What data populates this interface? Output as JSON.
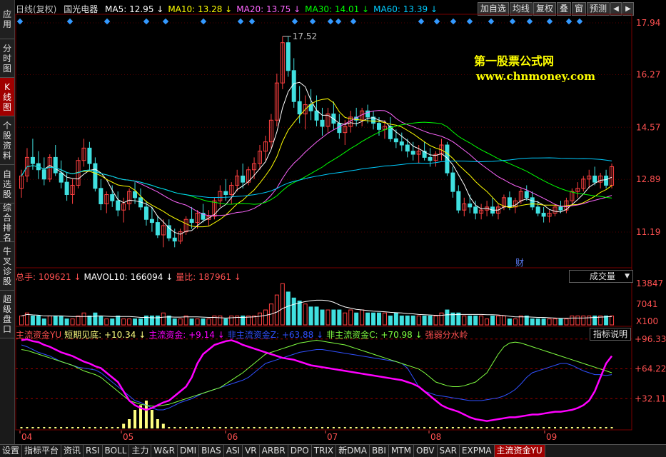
{
  "sidebar": [
    "应用",
    "分时图",
    "K线图",
    "个股资料",
    "自选股",
    "综合排名",
    "牛叉诊股",
    "超级盘口"
  ],
  "sidebar_active": 2,
  "header": {
    "period": "日线(复权)",
    "name": "国光电器",
    "ma": [
      {
        "label": "MA5: 12.95",
        "arrow": "↓",
        "color": "#ffffff"
      },
      {
        "label": "MA10: 13.28",
        "arrow": "↓",
        "color": "#ffff00"
      },
      {
        "label": "MA20: 13.75",
        "arrow": "↓",
        "color": "#ff66ff"
      },
      {
        "label": "MA30: 14.01",
        "arrow": "↓",
        "color": "#00ff00"
      },
      {
        "label": "MA60: 13.39",
        "arrow": "↓",
        "color": "#00ccff"
      }
    ]
  },
  "toolbar": [
    "加自选",
    "均线",
    "复权",
    "叠",
    "窗",
    "预测"
  ],
  "watermark": {
    "line1": "第一股票公式网",
    "line2": "www.chnmoney.com"
  },
  "price_axis": [
    "17.94",
    "16.27",
    "14.57",
    "12.89",
    "11.19"
  ],
  "max_label": "17.52",
  "cai": "财",
  "vol_legend": [
    {
      "label": "总手: 109621",
      "arrow": "↓",
      "color": "#ff5050"
    },
    {
      "label": "MAVOL10: 166094",
      "arrow": "↓",
      "color": "#ffffff"
    },
    {
      "label": "量比: 187961",
      "arrow": "↓",
      "color": "#ff5050"
    }
  ],
  "vol_dropdown": "成交量",
  "vol_axis": [
    "13847",
    "7041",
    "X100"
  ],
  "ind_legend": [
    {
      "label": "主流资金YU",
      "color": "#ff5050"
    },
    {
      "label": "短期见底: +10.34",
      "arrow": "↓",
      "color": "#ffff80"
    },
    {
      "label": "主流资金: +9.14",
      "arrow": "↓",
      "color": "#ff00ff"
    },
    {
      "label": "非主流资金Z: +63.88",
      "arrow": "↓",
      "color": "#3050ff"
    },
    {
      "label": "非主流资金C: +70.98",
      "arrow": "↓",
      "color": "#80ff40"
    },
    {
      "label": "强弱分水岭",
      "color": "#ff5050"
    }
  ],
  "ind_button": "指标说明",
  "ind_axis": [
    "+96.33",
    "+64.22",
    "+32.11"
  ],
  "months": [
    "04",
    "05",
    "06",
    "07",
    "08",
    "09"
  ],
  "bottom_tabs": [
    "设置",
    "指标平台",
    "资讯",
    "RSI",
    "BOLL",
    "主力",
    "W&R",
    "DMI",
    "BIAS",
    "ASI",
    "VR",
    "ARBR",
    "DPO",
    "TRIX",
    "新DMA",
    "BBI",
    "MTM",
    "OBV",
    "SAR",
    "EXPMA",
    "主流资金YU"
  ],
  "bottom_active": 20,
  "chart_data": {
    "type": "candlestick",
    "price_range": [
      10.5,
      18.1
    ],
    "candles": [
      [
        12.6,
        13.2,
        12.3,
        13.0
      ],
      [
        13.0,
        13.9,
        12.8,
        13.6
      ],
      [
        13.6,
        14.2,
        13.2,
        13.4
      ],
      [
        13.4,
        13.8,
        12.9,
        13.2
      ],
      [
        13.2,
        13.6,
        12.7,
        12.9
      ],
      [
        12.9,
        13.7,
        12.8,
        13.6
      ],
      [
        13.6,
        14.0,
        13.0,
        13.1
      ],
      [
        13.1,
        13.5,
        12.6,
        12.8
      ],
      [
        12.8,
        13.1,
        12.2,
        12.4
      ],
      [
        12.4,
        12.9,
        12.1,
        12.7
      ],
      [
        12.7,
        13.6,
        12.6,
        13.5
      ],
      [
        13.5,
        14.2,
        13.3,
        13.9
      ],
      [
        13.9,
        14.1,
        13.2,
        13.4
      ],
      [
        13.4,
        13.6,
        12.5,
        12.6
      ],
      [
        12.6,
        12.9,
        11.9,
        12.1
      ],
      [
        12.1,
        12.5,
        11.8,
        12.4
      ],
      [
        12.4,
        12.7,
        12.0,
        12.2
      ],
      [
        12.2,
        12.5,
        11.7,
        11.9
      ],
      [
        11.9,
        12.3,
        11.5,
        12.1
      ],
      [
        12.1,
        12.6,
        11.9,
        12.5
      ],
      [
        12.5,
        12.8,
        12.1,
        12.3
      ],
      [
        12.3,
        12.6,
        11.9,
        12.0
      ],
      [
        12.0,
        12.2,
        11.4,
        11.6
      ],
      [
        11.6,
        12.0,
        11.2,
        11.5
      ],
      [
        11.5,
        11.7,
        11.0,
        11.1
      ],
      [
        11.1,
        11.6,
        10.7,
        11.4
      ],
      [
        11.4,
        11.6,
        10.9,
        11.0
      ],
      [
        11.0,
        11.3,
        10.7,
        10.9
      ],
      [
        10.9,
        11.3,
        10.8,
        11.2
      ],
      [
        11.2,
        11.7,
        11.1,
        11.6
      ],
      [
        11.6,
        12.0,
        11.3,
        11.5
      ],
      [
        11.5,
        11.9,
        11.3,
        11.8
      ],
      [
        11.8,
        12.1,
        11.5,
        11.6
      ],
      [
        11.6,
        11.9,
        11.4,
        11.7
      ],
      [
        11.7,
        12.3,
        11.6,
        12.2
      ],
      [
        12.2,
        12.7,
        12.0,
        12.5
      ],
      [
        12.5,
        12.9,
        12.2,
        12.4
      ],
      [
        12.4,
        12.8,
        12.1,
        12.7
      ],
      [
        12.7,
        13.2,
        12.5,
        13.0
      ],
      [
        13.0,
        13.4,
        12.6,
        12.8
      ],
      [
        12.8,
        13.3,
        12.7,
        13.2
      ],
      [
        13.2,
        13.6,
        12.9,
        13.4
      ],
      [
        13.4,
        14.0,
        13.2,
        13.8
      ],
      [
        13.8,
        14.3,
        13.5,
        14.1
      ],
      [
        14.1,
        15.0,
        13.9,
        14.8
      ],
      [
        14.8,
        16.3,
        14.6,
        16.0
      ],
      [
        16.0,
        17.5,
        15.8,
        17.3
      ],
      [
        17.3,
        17.5,
        16.2,
        16.4
      ],
      [
        16.4,
        16.8,
        15.2,
        15.4
      ],
      [
        15.4,
        15.9,
        14.7,
        15.0
      ],
      [
        15.0,
        15.6,
        14.5,
        15.3
      ],
      [
        15.3,
        15.8,
        14.8,
        15.1
      ],
      [
        15.1,
        15.6,
        14.6,
        14.8
      ],
      [
        14.8,
        15.2,
        14.3,
        14.6
      ],
      [
        14.6,
        15.2,
        14.4,
        15.0
      ],
      [
        15.0,
        15.4,
        14.5,
        14.7
      ],
      [
        14.7,
        15.0,
        14.2,
        14.4
      ],
      [
        14.4,
        14.8,
        14.0,
        14.6
      ],
      [
        14.6,
        15.1,
        14.4,
        14.9
      ],
      [
        14.9,
        15.2,
        14.6,
        14.8
      ],
      [
        14.8,
        15.2,
        14.6,
        15.1
      ],
      [
        15.1,
        15.3,
        14.7,
        14.9
      ],
      [
        14.9,
        15.1,
        14.5,
        14.7
      ],
      [
        14.7,
        14.9,
        14.3,
        14.5
      ],
      [
        14.5,
        14.8,
        14.2,
        14.6
      ],
      [
        14.6,
        14.9,
        14.1,
        14.2
      ],
      [
        14.2,
        14.5,
        13.9,
        14.1
      ],
      [
        14.1,
        14.4,
        13.8,
        14.0
      ],
      [
        14.0,
        14.2,
        13.6,
        13.8
      ],
      [
        13.8,
        14.1,
        13.5,
        13.7
      ],
      [
        13.7,
        14.0,
        13.4,
        13.8
      ],
      [
        13.8,
        14.1,
        13.5,
        13.6
      ],
      [
        13.6,
        13.9,
        13.3,
        13.5
      ],
      [
        13.5,
        13.8,
        13.3,
        13.7
      ],
      [
        13.7,
        14.2,
        13.5,
        14.0
      ],
      [
        14.0,
        14.1,
        13.0,
        13.1
      ],
      [
        13.1,
        13.3,
        12.3,
        12.5
      ],
      [
        12.5,
        12.7,
        11.8,
        11.9
      ],
      [
        11.9,
        12.3,
        11.7,
        12.1
      ],
      [
        12.1,
        12.4,
        11.8,
        12.0
      ],
      [
        12.0,
        12.2,
        11.6,
        11.8
      ],
      [
        11.8,
        12.1,
        11.6,
        11.9
      ],
      [
        11.9,
        12.2,
        11.7,
        12.0
      ],
      [
        12.0,
        12.3,
        11.7,
        11.8
      ],
      [
        11.8,
        12.1,
        11.6,
        12.0
      ],
      [
        12.0,
        12.4,
        11.9,
        12.3
      ],
      [
        12.3,
        12.5,
        11.9,
        12.0
      ],
      [
        12.0,
        12.3,
        11.8,
        12.2
      ],
      [
        12.2,
        12.6,
        12.1,
        12.5
      ],
      [
        12.5,
        12.7,
        12.2,
        12.3
      ],
      [
        12.3,
        12.5,
        11.9,
        12.0
      ],
      [
        12.0,
        12.2,
        11.7,
        11.8
      ],
      [
        11.8,
        12.0,
        11.5,
        11.7
      ],
      [
        11.7,
        11.9,
        11.5,
        11.8
      ],
      [
        11.8,
        12.1,
        11.7,
        12.0
      ],
      [
        12.0,
        12.2,
        11.8,
        11.9
      ],
      [
        11.9,
        12.3,
        11.8,
        12.2
      ],
      [
        12.2,
        12.6,
        12.1,
        12.5
      ],
      [
        12.5,
        12.8,
        12.3,
        12.6
      ],
      [
        12.6,
        13.0,
        12.5,
        12.9
      ],
      [
        12.9,
        13.2,
        12.6,
        13.0
      ],
      [
        13.0,
        13.3,
        12.7,
        12.8
      ],
      [
        12.8,
        13.1,
        12.6,
        13.0
      ],
      [
        13.0,
        13.2,
        12.6,
        12.7
      ],
      [
        12.7,
        13.4,
        12.6,
        13.3
      ]
    ],
    "ma5_last": 12.95,
    "ma10_last": 13.28,
    "ma20_last": 13.75,
    "ma30_last": 14.01,
    "ma60_last": 13.39,
    "volume_max": 13847,
    "volume": [
      3,
      4,
      3,
      3,
      2,
      3,
      3,
      3,
      2,
      2,
      3,
      4,
      3,
      4,
      3,
      2,
      2,
      3,
      2,
      2,
      2,
      2,
      3,
      3,
      3,
      4,
      3,
      2,
      2,
      3,
      2,
      2,
      2,
      2,
      3,
      3,
      2,
      3,
      3,
      3,
      3,
      3,
      4,
      5,
      7,
      10,
      13.8,
      11,
      9,
      8,
      7,
      6,
      6,
      5,
      5,
      5,
      5,
      4,
      5,
      4,
      5,
      4,
      4,
      4,
      4,
      3,
      4,
      3,
      3,
      3,
      3,
      3,
      3,
      3,
      4,
      5,
      4,
      4,
      3,
      3,
      3,
      3,
      2,
      3,
      3,
      3,
      2,
      2,
      3,
      3,
      2,
      2,
      2,
      2,
      2,
      2,
      2,
      3,
      3,
      3,
      3,
      3,
      3,
      3,
      3,
      4
    ],
    "indicator_range": [
      0,
      100
    ],
    "short_bottom": [
      0,
      0,
      0,
      0,
      0,
      0,
      0,
      0,
      0,
      0,
      0,
      0,
      0,
      0,
      0,
      0,
      0,
      0,
      5,
      10,
      20,
      25,
      30,
      20,
      10,
      5,
      0,
      0,
      0,
      0,
      0,
      0,
      0,
      0,
      0,
      0,
      0,
      0,
      0,
      0,
      0,
      0,
      0,
      0,
      0,
      0,
      0,
      0,
      0,
      0,
      0,
      0,
      0,
      0,
      0,
      0,
      0,
      0,
      0,
      0,
      0,
      0,
      0,
      0,
      0,
      0,
      0,
      0,
      0,
      0,
      0,
      0,
      0,
      0,
      0,
      0,
      0,
      0,
      0,
      0,
      0,
      0,
      0,
      0,
      0,
      0,
      0,
      0,
      0,
      0,
      0,
      0,
      0,
      0,
      0,
      0,
      0,
      0,
      0,
      0,
      0,
      0,
      0,
      0,
      0,
      0,
      0,
      0
    ],
    "main_fund": [
      95,
      96,
      94,
      93,
      90,
      88,
      85,
      82,
      80,
      78,
      75,
      72,
      70,
      67,
      65,
      60,
      55,
      50,
      40,
      30,
      25,
      22,
      20,
      22,
      25,
      28,
      30,
      35,
      40,
      45,
      55,
      70,
      80,
      85,
      90,
      92,
      94,
      95,
      93,
      90,
      88,
      86,
      84,
      82,
      80,
      78,
      76,
      75,
      74,
      72,
      70,
      68,
      67,
      66,
      65,
      64,
      63,
      62,
      61,
      60,
      59,
      58,
      57,
      56,
      55,
      54,
      53,
      52,
      50,
      48,
      45,
      40,
      35,
      30,
      25,
      22,
      20,
      18,
      15,
      12,
      10,
      9,
      8,
      9,
      10,
      11,
      12,
      12,
      13,
      14,
      15,
      15,
      16,
      17,
      18,
      18,
      19,
      20,
      22,
      25,
      30,
      40,
      55,
      70,
      78,
      75,
      80,
      82
    ],
    "nonmain_z": [
      90,
      88,
      85,
      82,
      80,
      78,
      75,
      72,
      70,
      68,
      66,
      65,
      64,
      63,
      60,
      55,
      50,
      45,
      40,
      35,
      30,
      28,
      25,
      22,
      20,
      20,
      22,
      25,
      28,
      30,
      32,
      35,
      38,
      40,
      42,
      44,
      46,
      48,
      50,
      52,
      55,
      60,
      65,
      70,
      72,
      74,
      76,
      78,
      80,
      82,
      83,
      84,
      85,
      85,
      84,
      83,
      82,
      81,
      80,
      79,
      78,
      77,
      76,
      75,
      74,
      73,
      72,
      70,
      65,
      55,
      45,
      40,
      38,
      36,
      35,
      34,
      33,
      32,
      31,
      30,
      30,
      30,
      31,
      32,
      33,
      35,
      38,
      42,
      48,
      55,
      60,
      62,
      64,
      66,
      68,
      70,
      70,
      68,
      65,
      62,
      60,
      58,
      58,
      57,
      58,
      56,
      54,
      52
    ],
    "nonmain_c": [
      85,
      84,
      82,
      80,
      78,
      76,
      74,
      72,
      70,
      68,
      65,
      62,
      60,
      58,
      55,
      50,
      45,
      40,
      35,
      30,
      28,
      26,
      25,
      24,
      24,
      25,
      26,
      28,
      30,
      32,
      34,
      36,
      38,
      40,
      42,
      44,
      48,
      52,
      56,
      60,
      65,
      70,
      75,
      80,
      82,
      84,
      86,
      88,
      90,
      92,
      93,
      94,
      95,
      94,
      93,
      92,
      91,
      90,
      88,
      86,
      84,
      82,
      80,
      78,
      76,
      74,
      72,
      70,
      68,
      66,
      64,
      60,
      55,
      50,
      48,
      46,
      45,
      45,
      46,
      48,
      50,
      55,
      60,
      70,
      80,
      88,
      92,
      93,
      92,
      90,
      88,
      86,
      84,
      82,
      80,
      78,
      76,
      74,
      72,
      70,
      68,
      66,
      64,
      62,
      60,
      58,
      56,
      54
    ],
    "watershed": 50
  }
}
